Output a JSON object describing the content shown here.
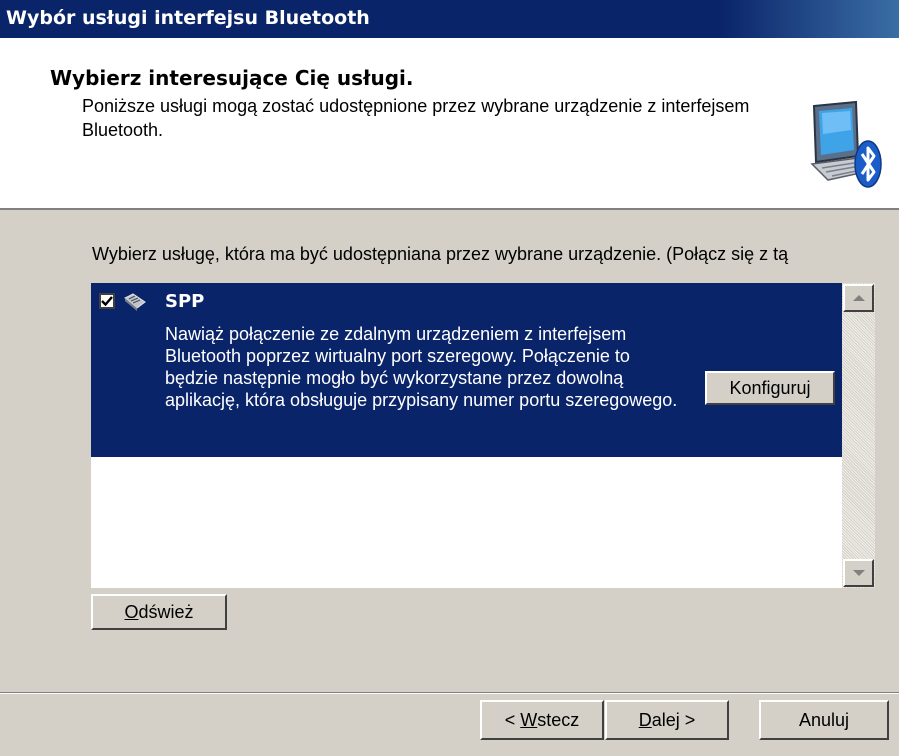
{
  "window": {
    "title": "Wybór usługi interfejsu Bluetooth"
  },
  "header": {
    "heading": "Wybierz interesujące Cię usługi.",
    "subtitle": "Poniższe usługi mogą zostać udostępnione przez wybrane urządzenie z interfejsem Bluetooth.",
    "icon": "bluetooth-computer-icon"
  },
  "instruction": "Wybierz usługę, która ma być udostępniana przez wybrane urządzenie. (Połącz się z tą",
  "services": [
    {
      "checked": true,
      "icon": "serial-port-icon",
      "name": "SPP",
      "description": "Nawiąż połączenie ze zdalnym urządzeniem z interfejsem Bluetooth poprzez wirtualny port szeregowy. Połączenie to będzie następnie mogło być wykorzystane przez dowolną aplikację, która obsługuje przypisany numer portu szeregowego.",
      "configure_label": "Konfiguruj"
    }
  ],
  "buttons": {
    "refresh": {
      "mnemonic": "O",
      "rest": "dśwież"
    },
    "back": {
      "prefix": "< ",
      "mnemonic": "W",
      "rest": "stecz"
    },
    "next": {
      "mnemonic": "D",
      "rest": "alej >"
    },
    "cancel": "Anuluj"
  },
  "colors": {
    "title_bar": "#0a246a",
    "selection": "#0a246a",
    "dialog_face": "#d4d0c8"
  }
}
